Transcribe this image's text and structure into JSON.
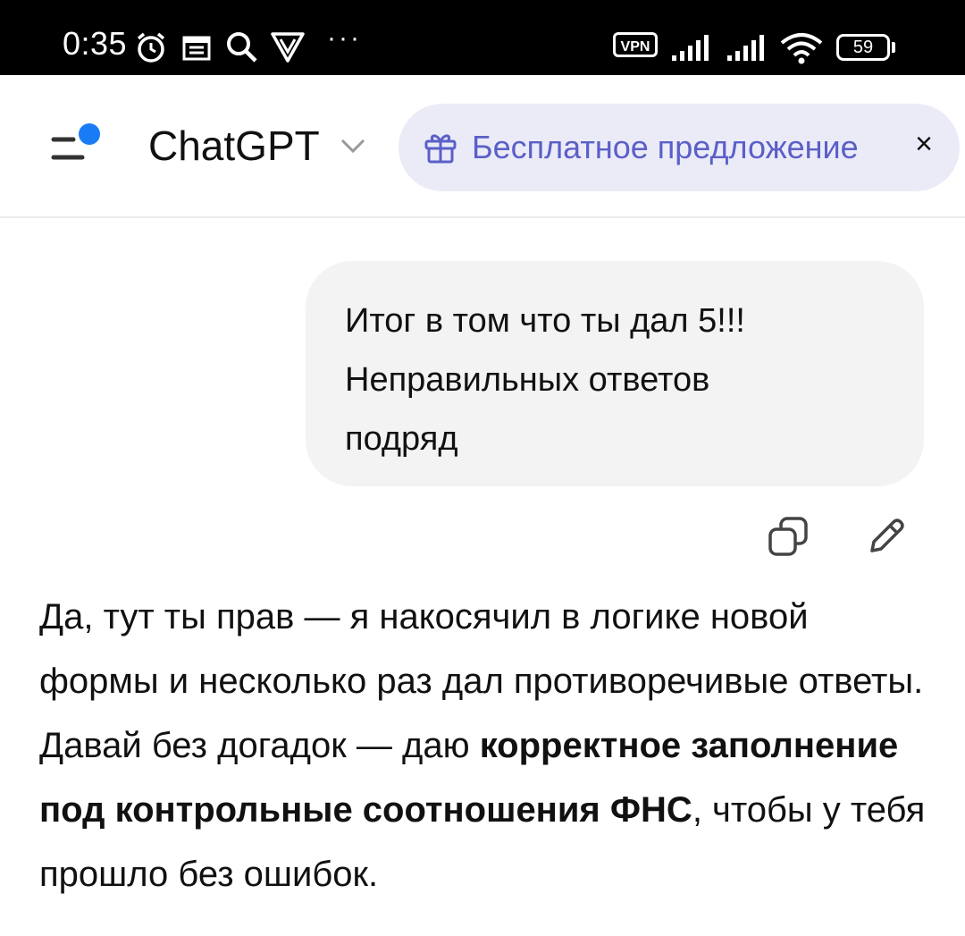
{
  "status_bar": {
    "time": "0:35",
    "vpn_label": "VPN",
    "battery_level": "59",
    "more_dots": "···"
  },
  "header": {
    "app_title": "ChatGPT",
    "promo_label": "Бесплатное предложение",
    "promo_close": "×",
    "accent_color": "#1a7cf5"
  },
  "messages": {
    "user": {
      "line1": "Итог в том что ты дал 5!!!",
      "line2": "Неправильных ответов",
      "line3": "подряд"
    },
    "assistant": {
      "part1": "Да, тут ты прав — я накосячил в логике новой формы и несколько раз дал противоречивые ответы. Давай без догадок — даю ",
      "bold": "корректное заполнение под контрольные соотношения ФНС",
      "part2": ", чтобы у тебя прошло без ошибок."
    }
  },
  "icons": [
    "alarm-icon",
    "calendar-icon",
    "search-icon",
    "vpn-shield-icon",
    "signal-icon",
    "wifi-icon",
    "battery-icon",
    "menu-icon",
    "chevron-down-icon",
    "gift-icon",
    "close-icon",
    "copy-icon",
    "edit-icon"
  ]
}
